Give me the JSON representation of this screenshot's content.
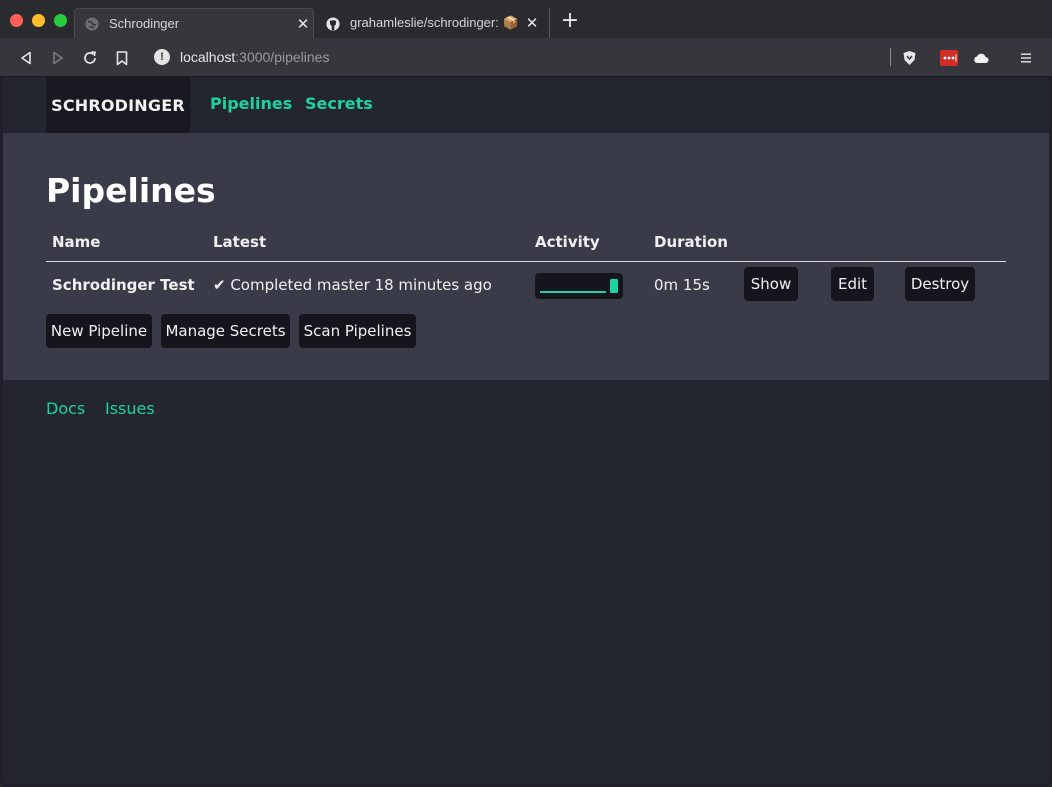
{
  "browser": {
    "tabs": [
      {
        "title": "Schrodinger",
        "active": true
      },
      {
        "title": "grahamleslie/schrodinger: 📦 Sch",
        "active": false
      }
    ],
    "url": {
      "host": "localhost",
      "path": ":3000/pipelines"
    },
    "icons": [
      "back-icon",
      "forward-icon",
      "reload-icon",
      "bookmark-icon",
      "site-info-icon",
      "brave-shield-icon",
      "lastpass-icon",
      "cloud-icon",
      "menu-icon"
    ],
    "colors": {
      "accent": "#1fd1a1",
      "lastpass": "#d32d27"
    }
  },
  "nav": {
    "brand": "SCHRODINGER",
    "links": [
      "Pipelines",
      "Secrets"
    ]
  },
  "main": {
    "title": "Pipelines",
    "columns": [
      "Name",
      "Latest",
      "Activity",
      "Duration"
    ],
    "rows": [
      {
        "name": "Schrodinger Test",
        "latest": "✔ Completed master 18 minutes ago",
        "activity_fraction": 0.85,
        "duration": "0m 15s",
        "actions": [
          "Show",
          "Edit",
          "Destroy"
        ]
      }
    ],
    "buttons": [
      "New Pipeline",
      "Manage Secrets",
      "Scan Pipelines"
    ]
  },
  "footer": {
    "links": [
      "Docs",
      "Issues"
    ]
  }
}
